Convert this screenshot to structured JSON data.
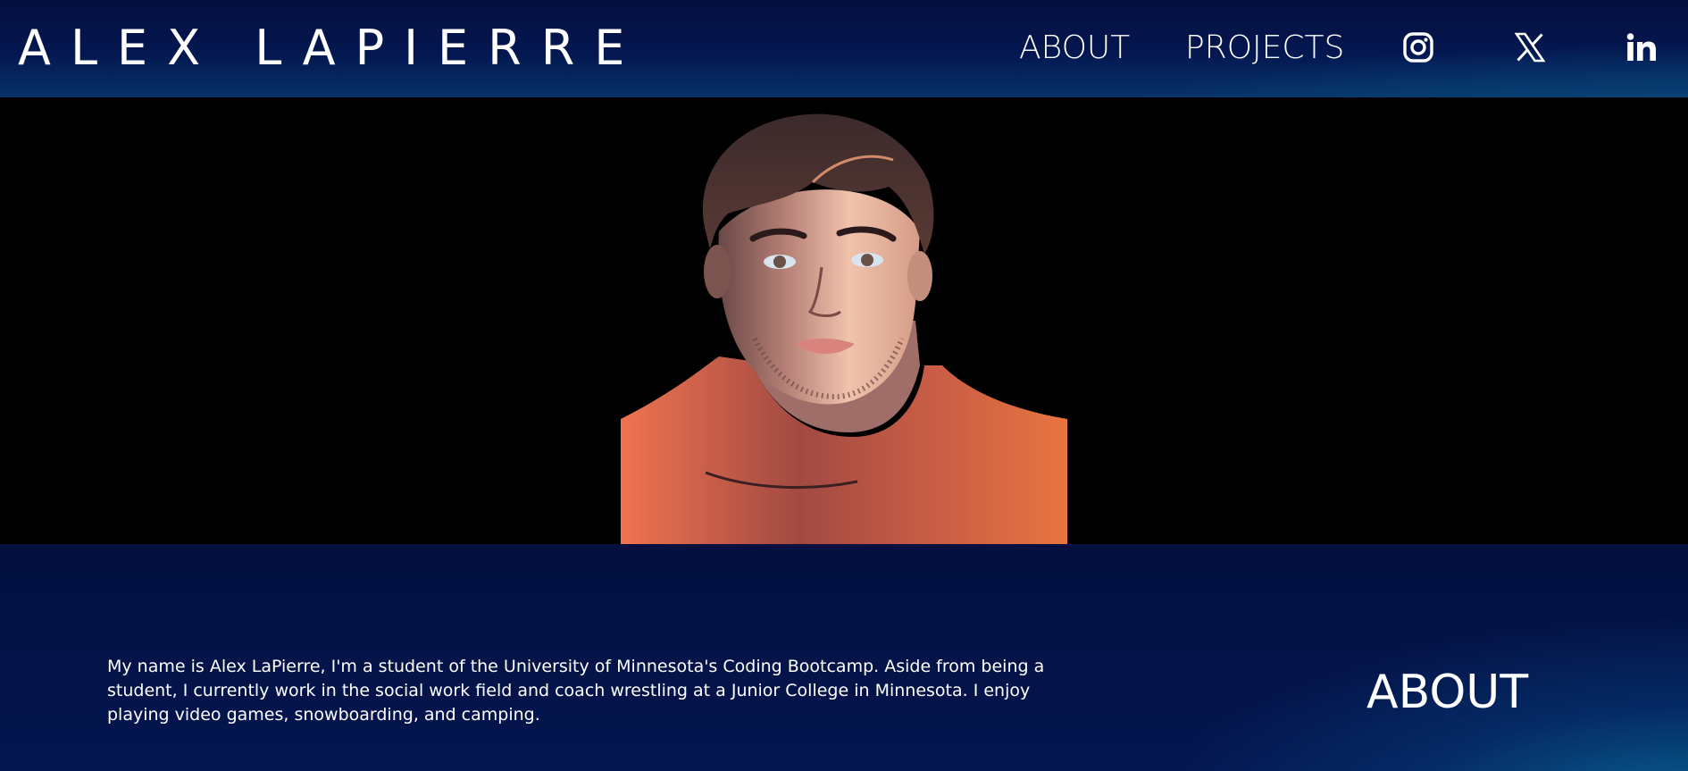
{
  "header": {
    "brand": "ALEX LAPIERRE",
    "nav": [
      {
        "label": "ABOUT"
      },
      {
        "label": "PROJECTS"
      }
    ],
    "social": [
      {
        "icon": "instagram-icon"
      },
      {
        "icon": "x-twitter-icon"
      },
      {
        "icon": "linkedin-icon"
      }
    ]
  },
  "hero": {
    "portrait_icon": "portrait-illustration"
  },
  "about": {
    "heading": "ABOUT",
    "text": "My name is Alex LaPierre, I'm a student of the University of Minnesota's Coding Bootcamp. Aside from being a student, I currently work in the social work field and coach wrestling at a Junior College in Minnesota. I enjoy playing video games, snowboarding, and camping."
  },
  "colors": {
    "header_dark": "#050f3f",
    "header_accent": "#0c7aa0",
    "hero_background": "#000000",
    "text": "#ffffff"
  }
}
